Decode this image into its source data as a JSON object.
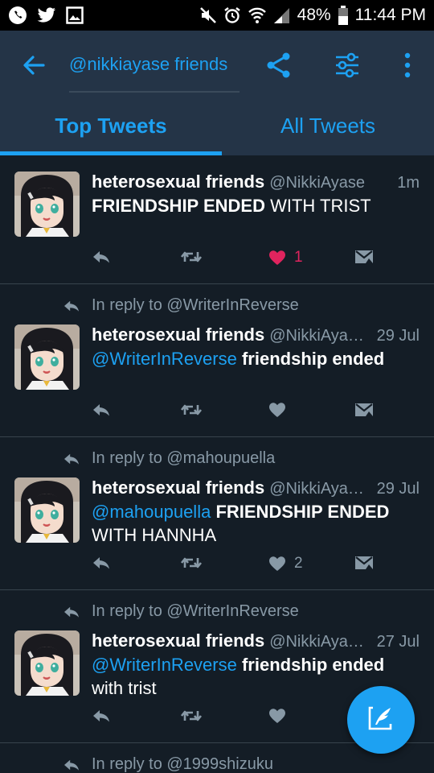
{
  "status_bar": {
    "battery": "48%",
    "time": "11:44 PM",
    "left_icons": [
      "phone-icon",
      "twitter-icon",
      "gallery-icon"
    ],
    "right_icons": [
      "mute-icon",
      "alarm-icon",
      "wifi-icon",
      "signal-icon",
      "battery-icon"
    ]
  },
  "header": {
    "search_query": "@nikkiayase friends",
    "tabs": [
      {
        "label": "Top Tweets",
        "active": true
      },
      {
        "label": "All Tweets",
        "active": false
      }
    ]
  },
  "colors": {
    "accent": "#1da1f2",
    "background": "#141d26",
    "header": "#243447",
    "muted": "#8899a6",
    "like": "#e0245e"
  },
  "tweets": [
    {
      "name": "heterosexual friends",
      "handle": "@NikkiAyase",
      "time": "1m",
      "text_parts": [
        "FRIENDSHIP ENDED",
        " WITH TRIST"
      ],
      "likes": "1",
      "liked": true
    },
    {
      "reply_to": "In reply to @WriterInReverse",
      "name": "heterosexual friends",
      "handle": "@NikkiAya…",
      "time": "29 Jul",
      "text_parts": [
        "@WriterInReverse",
        " friendship ended"
      ],
      "likes": "",
      "liked": false
    },
    {
      "reply_to": "In reply to @mahoupuella",
      "name": "heterosexual friends",
      "handle": "@NikkiAya…",
      "time": "29 Jul",
      "text_parts": [
        "@mahoupuella",
        " FRIENDSHIP ENDED",
        "WITH HANNHA"
      ],
      "likes": "2",
      "liked": false
    },
    {
      "reply_to": "In reply to @WriterInReverse",
      "name": "heterosexual friends",
      "handle": "@NikkiAya…",
      "time": "27 Jul",
      "text_parts": [
        "@WriterInReverse",
        " friendship ended",
        "with trist"
      ],
      "likes": "",
      "liked": false
    },
    {
      "reply_to": "In reply to @1999shizuku"
    }
  ]
}
